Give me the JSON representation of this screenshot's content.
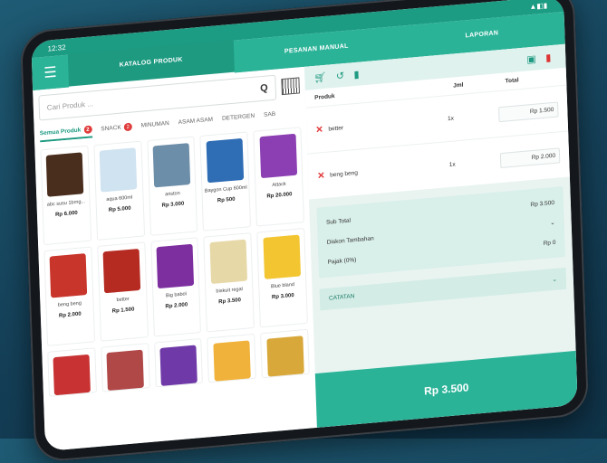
{
  "status": {
    "time": "12:32",
    "icons": "▲◧▮"
  },
  "nav": {
    "menu_icon": "menu-icon",
    "tabs": [
      {
        "label": "KATALOG PRODUK"
      },
      {
        "label": "PESANAN MANUAL"
      },
      {
        "label": "LAPORAN"
      }
    ]
  },
  "search": {
    "placeholder": "Cari Produk ..."
  },
  "categories": [
    {
      "label": "Semua Produk",
      "badge": "2"
    },
    {
      "label": "SNACK",
      "badge": "2"
    },
    {
      "label": "MINUMAN"
    },
    {
      "label": "ASAM ASAM"
    },
    {
      "label": "DETERGEN"
    },
    {
      "label": "SAB"
    }
  ],
  "products": [
    {
      "name": "abc susu 1brng...",
      "price": "Rp 6.000",
      "color": "#4a2e1d"
    },
    {
      "name": "aqua 600ml",
      "price": "Rp 5.000",
      "color": "#cfe3f1"
    },
    {
      "name": "ariston",
      "price": "Rp 3.000",
      "color": "#6d8ea8"
    },
    {
      "name": "Baygon Cup 600ml",
      "price": "Rp 500",
      "color": "#2f6db5"
    },
    {
      "name": "Attack",
      "price": "Rp 20.000",
      "color": "#8c3fb3"
    },
    {
      "name": "beng beng",
      "price": "Rp 2.000",
      "color": "#c8352b"
    },
    {
      "name": "better",
      "price": "Rp 1.500",
      "color": "#b52b22"
    },
    {
      "name": "Big babol",
      "price": "Rp 2.000",
      "color": "#7d2fa0"
    },
    {
      "name": "biskuit regal",
      "price": "Rp 3.500",
      "color": "#e7d8a8"
    },
    {
      "name": "Blue bland",
      "price": "Rp 3.000",
      "color": "#f2c531"
    }
  ],
  "products_row3_colors": [
    "#c83232",
    "#b04848",
    "#6f3aa8",
    "#f0b23a",
    "#d9a83a"
  ],
  "order": {
    "headers": {
      "product": "Produk",
      "qty": "Jml",
      "total": "Total"
    },
    "items": [
      {
        "name": "better",
        "qty": "1x",
        "price": "Rp 1.500"
      },
      {
        "name": "beng beng",
        "qty": "1x",
        "price": "Rp 2.000"
      }
    ]
  },
  "summary": {
    "subtotal_label": "Sub Total",
    "subtotal_value": "Rp 3.500",
    "discount_label": "Diskon Tambahan",
    "tax_label": "Pajak (0%)",
    "tax_value": "Rp 0"
  },
  "notes": {
    "label": "CATATAN"
  },
  "pay": {
    "label": "Rp 3.500"
  },
  "accent": "#2bb398"
}
